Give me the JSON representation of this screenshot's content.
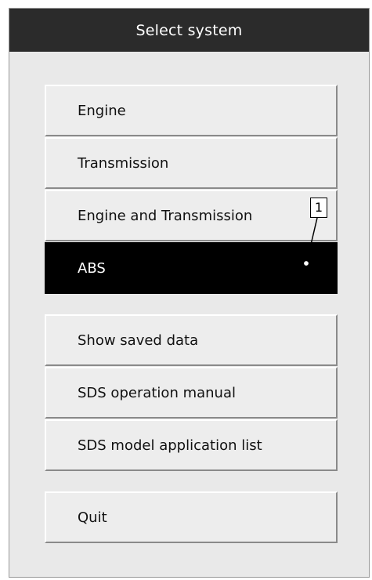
{
  "window": {
    "title": "Select system"
  },
  "systems": {
    "engine": "Engine",
    "transmission": "Transmission",
    "engine_and_transmission": "Engine and Transmission",
    "abs": "ABS"
  },
  "tools": {
    "show_saved_data": "Show saved data",
    "operation_manual": "SDS operation manual",
    "model_application_list": "SDS model application list"
  },
  "quit_label": "Quit",
  "callout": {
    "number": "1"
  },
  "colors": {
    "title_bar": "#2b2b2b",
    "selected_bg": "#000000",
    "button_bg": "#ededed",
    "window_bg": "#e9e9e9"
  }
}
